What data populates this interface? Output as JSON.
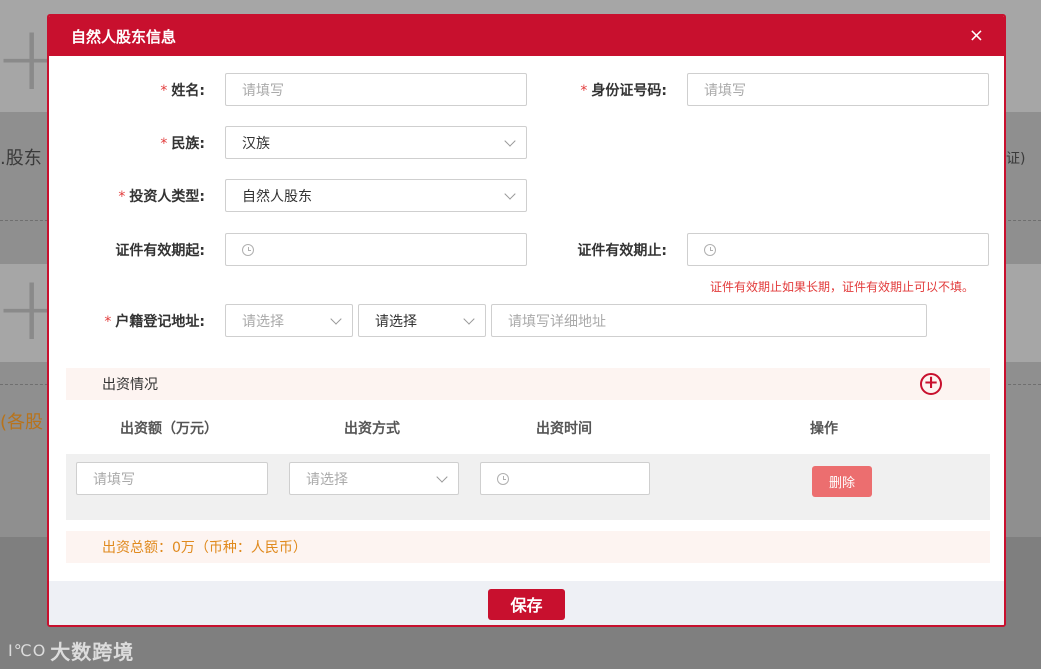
{
  "background": {
    "text_shareholder": ".股东",
    "text_each": "(各股",
    "text_cert": "证)"
  },
  "watermark": {
    "logo": "I℃O",
    "text": "大数跨境"
  },
  "modal": {
    "title": "自然人股东信息",
    "close": "×",
    "fields": {
      "name": {
        "label": "姓名:",
        "placeholder": "请填写"
      },
      "id_number": {
        "label": "身份证号码:",
        "placeholder": "请填写"
      },
      "ethnicity": {
        "label": "民族:",
        "value": "汉族"
      },
      "investor_type": {
        "label": "投资人类型:",
        "value": "自然人股东"
      },
      "valid_from": {
        "label": "证件有效期起:"
      },
      "valid_to": {
        "label": "证件有效期止:"
      },
      "validity_hint": "证件有效期止如果长期，证件有效期止可以不填。",
      "address": {
        "label": "户籍登记地址:",
        "select1": "请选择",
        "select2": "请选择",
        "detail_placeholder": "请填写详细地址"
      }
    },
    "investment": {
      "section_title": "出资情况",
      "add_icon": "+",
      "columns": [
        "出资额（万元）",
        "出资方式",
        "出资时间",
        "操作"
      ],
      "row": {
        "amount_placeholder": "请填写",
        "method": "请选择",
        "delete_label": "删除"
      },
      "total": "出资总额：0万（币种：人民币）"
    },
    "save_label": "保存"
  }
}
